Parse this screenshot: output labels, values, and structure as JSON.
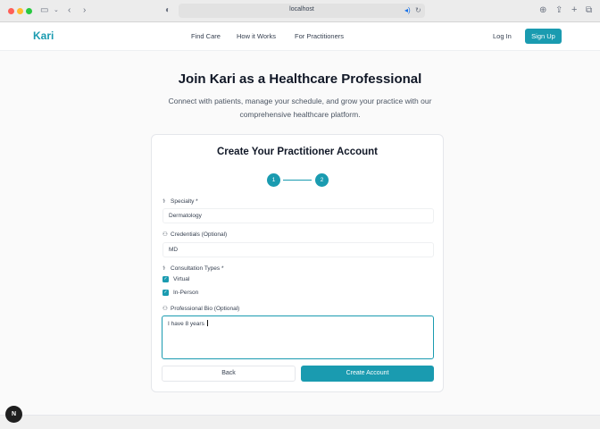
{
  "browser": {
    "address": "localhost",
    "icons": [
      "sidebar-icon",
      "back-arrow-icon",
      "forward-arrow-icon",
      "shield-icon",
      "audio-icon",
      "reload-icon",
      "download-icon",
      "share-icon",
      "new-tab-icon",
      "tabs-overview-icon"
    ]
  },
  "header": {
    "logo": "Kari",
    "nav": [
      "Find Care",
      "How it Works",
      "For Practitioners"
    ],
    "login": "Log In",
    "signup": "Sign Up"
  },
  "page": {
    "title": "Join Kari as a Healthcare Professional",
    "subtitle": "Connect with patients, manage your schedule, and grow your practice with our comprehensive healthcare platform."
  },
  "form": {
    "title": "Create Your Practitioner Account",
    "steps": [
      "1",
      "2"
    ],
    "specialty": {
      "label": "Specialty *",
      "value": "Dermatology"
    },
    "credentials": {
      "label": "Credentials (Optional)",
      "value": "MD"
    },
    "consultation": {
      "label": "Consultation Types *",
      "options": [
        {
          "label": "Virtual",
          "checked": true
        },
        {
          "label": "In-Person",
          "checked": true
        }
      ]
    },
    "bio": {
      "label": "Professional Bio (Optional)",
      "value": "I have 8 years "
    },
    "back": "Back",
    "submit": "Create Account"
  },
  "badge": "N",
  "colors": {
    "accent": "#1a9bb0"
  }
}
